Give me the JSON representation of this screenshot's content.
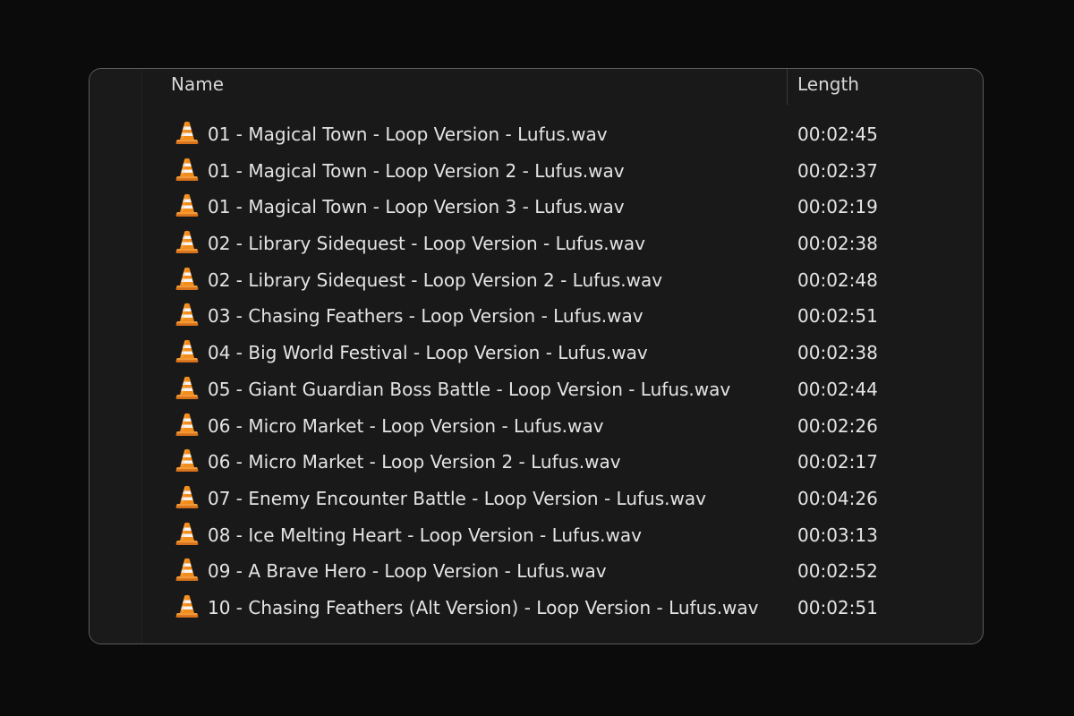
{
  "columns": {
    "name": "Name",
    "length": "Length"
  },
  "file_icon": "vlc-cone-icon",
  "accent_colors": {
    "cone_orange": "#f28c1a",
    "cone_white": "#ffffff"
  },
  "files": [
    {
      "name": "01 - Magical Town - Loop Version - Lufus.wav",
      "length": "00:02:45"
    },
    {
      "name": "01 - Magical Town - Loop Version 2 - Lufus.wav",
      "length": "00:02:37"
    },
    {
      "name": "01 - Magical Town - Loop Version 3 - Lufus.wav",
      "length": "00:02:19"
    },
    {
      "name": "02 - Library Sidequest - Loop Version - Lufus.wav",
      "length": "00:02:38"
    },
    {
      "name": "02 - Library Sidequest - Loop Version 2 - Lufus.wav",
      "length": "00:02:48"
    },
    {
      "name": "03 - Chasing Feathers - Loop Version - Lufus.wav",
      "length": "00:02:51"
    },
    {
      "name": "04 - Big World Festival - Loop Version - Lufus.wav",
      "length": "00:02:38"
    },
    {
      "name": "05 - Giant Guardian Boss Battle - Loop Version - Lufus.wav",
      "length": "00:02:44"
    },
    {
      "name": "06 - Micro Market - Loop Version - Lufus.wav",
      "length": "00:02:26"
    },
    {
      "name": "06 - Micro Market - Loop Version 2 - Lufus.wav",
      "length": "00:02:17"
    },
    {
      "name": "07 - Enemy Encounter Battle - Loop Version - Lufus.wav",
      "length": "00:04:26"
    },
    {
      "name": "08 - Ice Melting Heart - Loop Version - Lufus.wav",
      "length": "00:03:13"
    },
    {
      "name": "09 - A Brave Hero - Loop Version - Lufus.wav",
      "length": "00:02:52"
    },
    {
      "name": "10 - Chasing Feathers (Alt Version) - Loop Version - Lufus.wav",
      "length": "00:02:51"
    }
  ]
}
